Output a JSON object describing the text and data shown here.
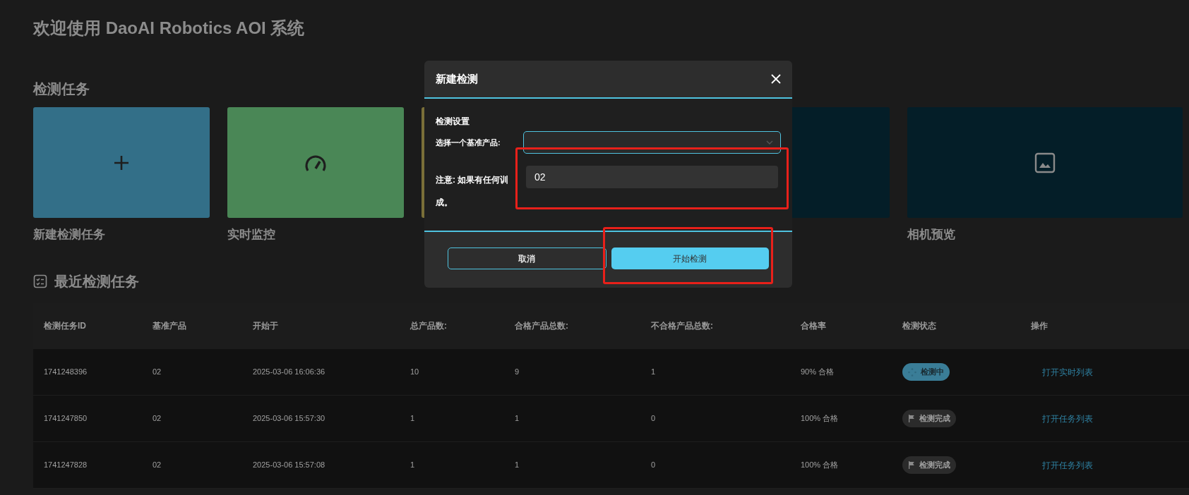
{
  "page_title": "欢迎使用 DaoAI Robotics AOI 系统",
  "tasks_heading": "检测任务",
  "cards": [
    {
      "kind": "plus",
      "label": "新建检测任务",
      "color": "#336f88"
    },
    {
      "kind": "gauge",
      "label": "实时监控",
      "color": "#4a8756"
    },
    {
      "kind": "blank",
      "color": "#7a6f38"
    },
    {
      "kind": "blank",
      "color": "#041e28"
    },
    {
      "kind": "image",
      "label": "相机预览",
      "color": "#041e28"
    }
  ],
  "recent_heading": "最近检测任务",
  "table": {
    "columns": [
      "检测任务ID",
      "基准产品",
      "开始于",
      "总产品数:",
      "合格产品总数:",
      "不合格产品总数:",
      "合格率",
      "检测状态",
      "操作"
    ],
    "rows": [
      {
        "cells": [
          "1741248396",
          "02",
          "2025-03-06 16:06:36",
          "10",
          "9",
          "1",
          "90% 合格"
        ],
        "status": {
          "kind": "running",
          "label": "检测中"
        },
        "action": "打开实时列表"
      },
      {
        "cells": [
          "1741247850",
          "02",
          "2025-03-06 15:57:30",
          "1",
          "1",
          "0",
          "100% 合格"
        ],
        "status": {
          "kind": "done",
          "label": "检测完成"
        },
        "action": "打开任务列表"
      },
      {
        "cells": [
          "1741247828",
          "02",
          "2025-03-06 15:57:08",
          "1",
          "1",
          "0",
          "100% 合格"
        ],
        "status": {
          "kind": "done",
          "label": "检测完成"
        },
        "action": "打开任务列表"
      }
    ]
  },
  "dialog": {
    "title": "新建检测",
    "section": "检测设置",
    "select_label": "选择一个基准产品:",
    "option": "02",
    "note_lines": [
      "注意: 如果有任何训",
      "成。"
    ],
    "buttons": [
      {
        "kind": "secondary",
        "label": "取消"
      },
      {
        "kind": "primary",
        "label": "开始检测"
      }
    ]
  }
}
